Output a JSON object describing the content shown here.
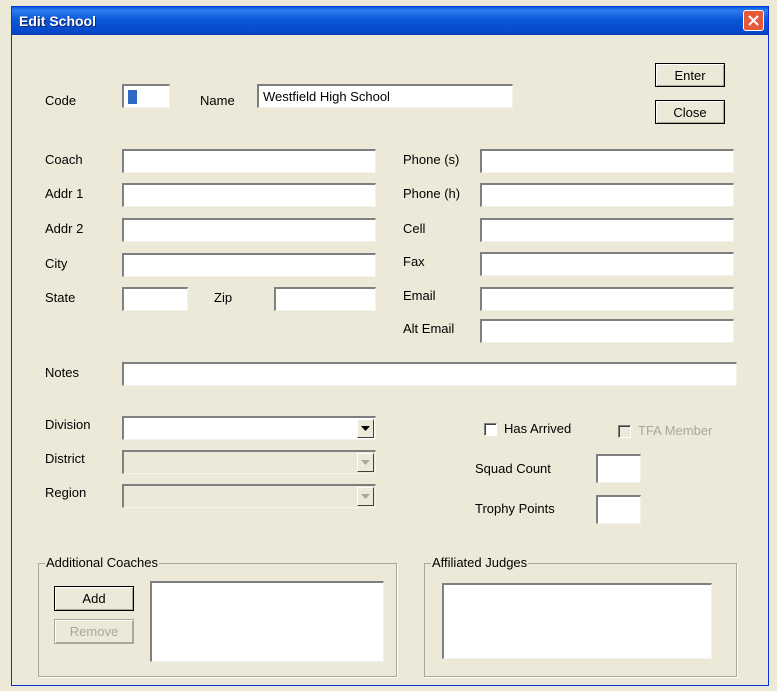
{
  "window": {
    "title": "Edit School",
    "close_icon": "close-icon"
  },
  "buttons": {
    "enter": "Enter",
    "close": "Close",
    "add": "Add",
    "remove": "Remove"
  },
  "labels": {
    "code": "Code",
    "name": "Name",
    "coach": "Coach",
    "addr1": "Addr 1",
    "addr2": "Addr 2",
    "city": "City",
    "state": "State",
    "zip": "Zip",
    "phone_s": "Phone (s)",
    "phone_h": "Phone (h)",
    "cell": "Cell",
    "fax": "Fax",
    "email": "Email",
    "alt_email": "Alt Email",
    "notes": "Notes",
    "division": "Division",
    "district": "District",
    "region": "Region",
    "has_arrived": "Has Arrived",
    "tfa_member": "TFA Member",
    "squad_count": "Squad Count",
    "trophy_points": "Trophy Points",
    "additional_coaches": "Additional Coaches",
    "affiliated_judges": "Affiliated Judges"
  },
  "values": {
    "code": "",
    "name": "Westfield High School",
    "coach": "",
    "addr1": "",
    "addr2": "",
    "city": "",
    "state": "",
    "zip": "",
    "phone_s": "",
    "phone_h": "",
    "cell": "",
    "fax": "",
    "email": "",
    "alt_email": "",
    "notes": "",
    "division": "",
    "district": "",
    "region": "",
    "squad_count": "",
    "trophy_points": "",
    "has_arrived": false,
    "tfa_member": false
  },
  "colors": {
    "titlebar": "#0b58d8",
    "dialog_bg": "#ece9d8",
    "close_button": "#e5593b",
    "disabled_text": "#aca899"
  }
}
